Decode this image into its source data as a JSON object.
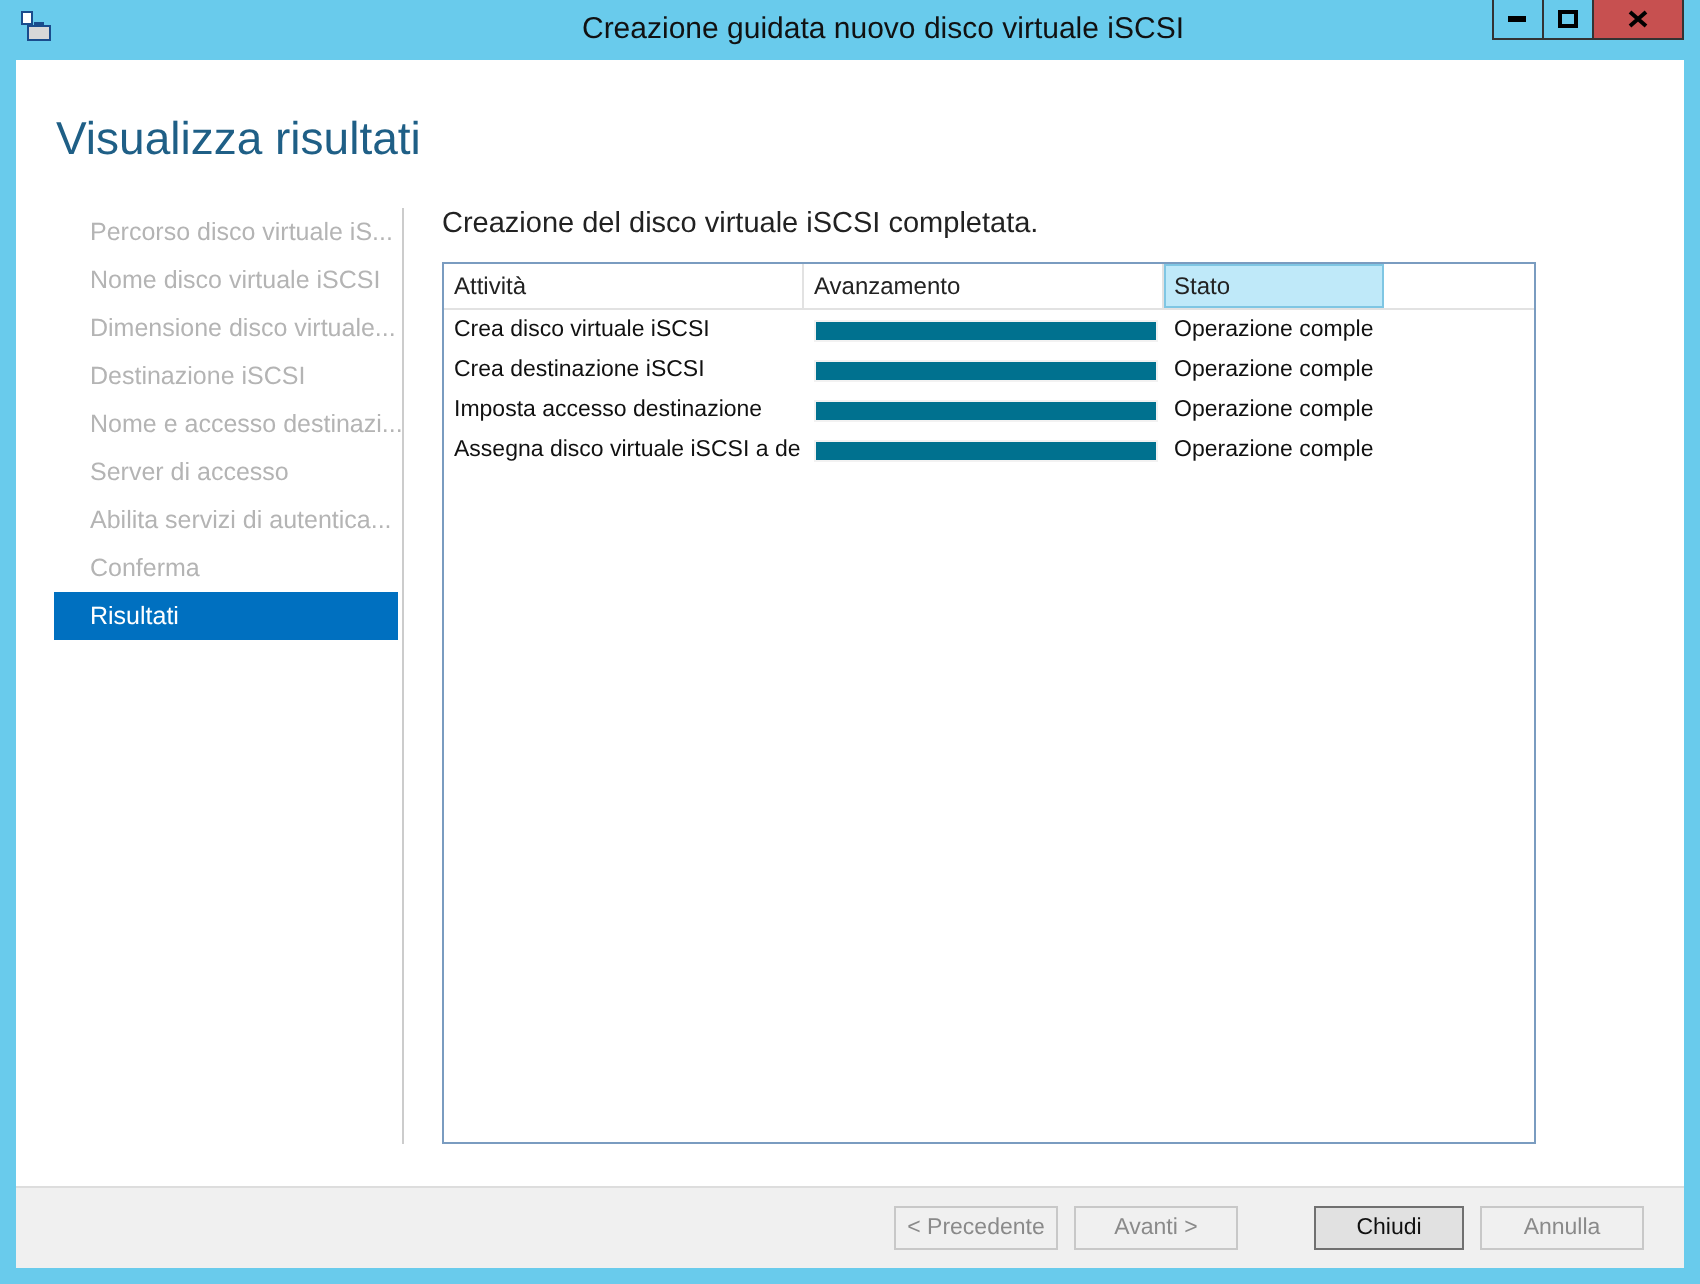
{
  "window": {
    "title": "Creazione guidata nuovo disco virtuale iSCSI"
  },
  "heading": "Visualizza risultati",
  "sidebar": {
    "items": [
      {
        "label": "Percorso disco virtuale iS...",
        "selected": false,
        "disabled": true
      },
      {
        "label": "Nome disco virtuale iSCSI",
        "selected": false,
        "disabled": true
      },
      {
        "label": "Dimensione disco virtuale...",
        "selected": false,
        "disabled": true
      },
      {
        "label": "Destinazione iSCSI",
        "selected": false,
        "disabled": true
      },
      {
        "label": "Nome e accesso destinazi...",
        "selected": false,
        "disabled": true
      },
      {
        "label": "Server di accesso",
        "selected": false,
        "disabled": true
      },
      {
        "label": "Abilita servizi di autentica...",
        "selected": false,
        "disabled": true
      },
      {
        "label": "Conferma",
        "selected": false,
        "disabled": true
      },
      {
        "label": "Risultati",
        "selected": true,
        "disabled": false
      }
    ]
  },
  "message": "Creazione del disco virtuale iSCSI completata.",
  "table": {
    "columns": [
      {
        "label": "Attività",
        "selected": false
      },
      {
        "label": "Avanzamento",
        "selected": false
      },
      {
        "label": "Stato",
        "selected": true
      }
    ],
    "rows": [
      {
        "task": "Crea disco virtuale iSCSI",
        "level": 1,
        "status": "Operazione comple"
      },
      {
        "task": "Crea destinazione iSCSI",
        "level": 1,
        "status": "Operazione comple"
      },
      {
        "task": "Imposta accesso destinazione",
        "level": 1,
        "status": "Operazione comple"
      },
      {
        "task": "Assegna disco virtuale iSCSI a de",
        "level": 1,
        "status": "Operazione comple"
      }
    ]
  },
  "buttons": [
    {
      "label": "< Precedente",
      "disabled": true,
      "default": false
    },
    {
      "label": "Avanti >",
      "disabled": true,
      "default": false
    },
    {
      "label": "Chiudi",
      "disabled": false,
      "default": true
    },
    {
      "label": "Annulla",
      "disabled": true,
      "default": false
    }
  ]
}
